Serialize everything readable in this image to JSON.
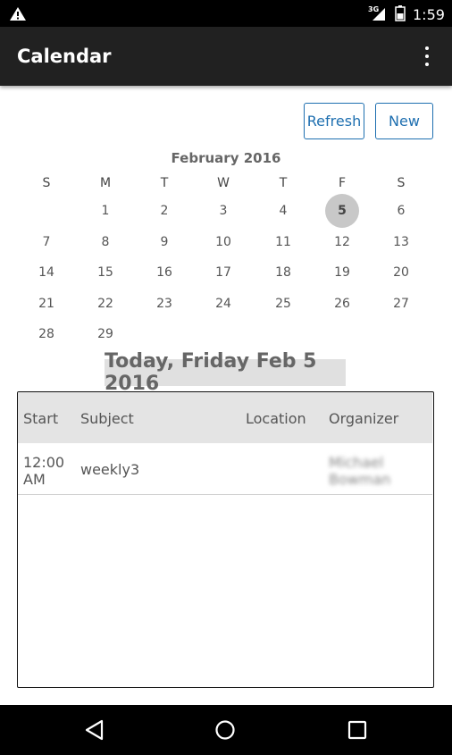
{
  "status_bar": {
    "network_label": "3G",
    "time": "1:59",
    "warning_icon": "warning-icon",
    "battery_icon": "battery-icon",
    "signal_icon": "signal-icon"
  },
  "app_bar": {
    "title": "Calendar",
    "overflow_icon": "more-vert-icon"
  },
  "actions": {
    "refresh_label": "Refresh",
    "new_label": "New"
  },
  "calendar": {
    "month_title": "February 2016",
    "weekdays": [
      "S",
      "M",
      "T",
      "W",
      "T",
      "F",
      "S"
    ],
    "selected_day": "5",
    "weeks": [
      [
        "",
        "1",
        "2",
        "3",
        "4",
        "5",
        "6"
      ],
      [
        "7",
        "8",
        "9",
        "10",
        "11",
        "12",
        "13"
      ],
      [
        "14",
        "15",
        "16",
        "17",
        "18",
        "19",
        "20"
      ],
      [
        "21",
        "22",
        "23",
        "24",
        "25",
        "26",
        "27"
      ],
      [
        "28",
        "29",
        "",
        "",
        "",
        "",
        ""
      ]
    ]
  },
  "today_banner": "Today, Friday Feb 5 2016",
  "events_table": {
    "headers": {
      "start": "Start",
      "subject": "Subject",
      "location": "Location",
      "organizer": "Organizer"
    },
    "rows": [
      {
        "start_line1": "12:00",
        "start_line2": "AM",
        "subject": "weekly3",
        "location": "",
        "organizer_line1": "Michael",
        "organizer_line2": "Bowman"
      }
    ]
  },
  "nav_bar": {
    "back_icon": "back-icon",
    "home_icon": "home-icon",
    "recents_icon": "recents-icon"
  }
}
